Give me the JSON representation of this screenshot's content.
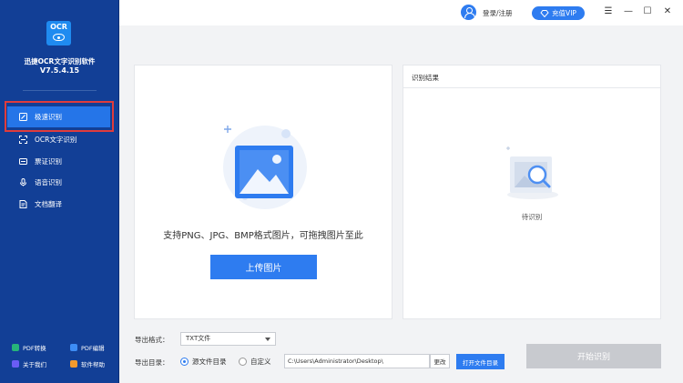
{
  "sidebar": {
    "logo_text": "OCR",
    "app_name": "迅捷OCR文字识别软件",
    "version": "V7.5.4.15",
    "nav": [
      {
        "label": "极速识别",
        "icon": "quick-scan-icon",
        "active": true
      },
      {
        "label": "OCR文字识别",
        "icon": "scan-frame-icon",
        "active": false
      },
      {
        "label": "票证识别",
        "icon": "ticket-icon",
        "active": false
      },
      {
        "label": "语音识别",
        "icon": "microphone-icon",
        "active": false
      },
      {
        "label": "文档翻译",
        "icon": "document-translate-icon",
        "active": false
      }
    ],
    "footer": [
      {
        "label": "PDF转换",
        "icon": "pdf-convert-icon",
        "color": "#27b57a"
      },
      {
        "label": "PDF编辑",
        "icon": "pdf-edit-icon",
        "color": "#3d8df5"
      },
      {
        "label": "关于我们",
        "icon": "about-icon",
        "color": "#6a5cf5"
      },
      {
        "label": "软件帮助",
        "icon": "help-icon",
        "color": "#f39a2d"
      }
    ]
  },
  "topbar": {
    "login_label": "登录/注册",
    "vip_label": "充值VIP",
    "menu_glyph": "☰",
    "minimize_glyph": "—",
    "maximize_glyph": "☐",
    "close_glyph": "✕"
  },
  "upload": {
    "hint": "支持PNG、JPG、BMP格式图片，可拖拽图片至此",
    "button_label": "上传图片"
  },
  "result": {
    "title": "识别结果",
    "pending_label": "待识别"
  },
  "export": {
    "format_label": "导出格式：",
    "format_value": "TXT文件",
    "dir_label": "导出目录：",
    "radio_source": "源文件目录",
    "radio_custom": "自定义",
    "selected_radio": "source",
    "path_value": "C:\\Users\\Administrator\\Desktop\\",
    "change_label": "更改",
    "open_dir_label": "打开文件目录",
    "start_label": "开始识别"
  },
  "colors": {
    "sidebar_bg": "#123f96",
    "accent": "#2e7cf0",
    "active_nav": "#2575e8",
    "highlight_outline": "#e03c3c",
    "disabled_button": "#c8cacf"
  }
}
